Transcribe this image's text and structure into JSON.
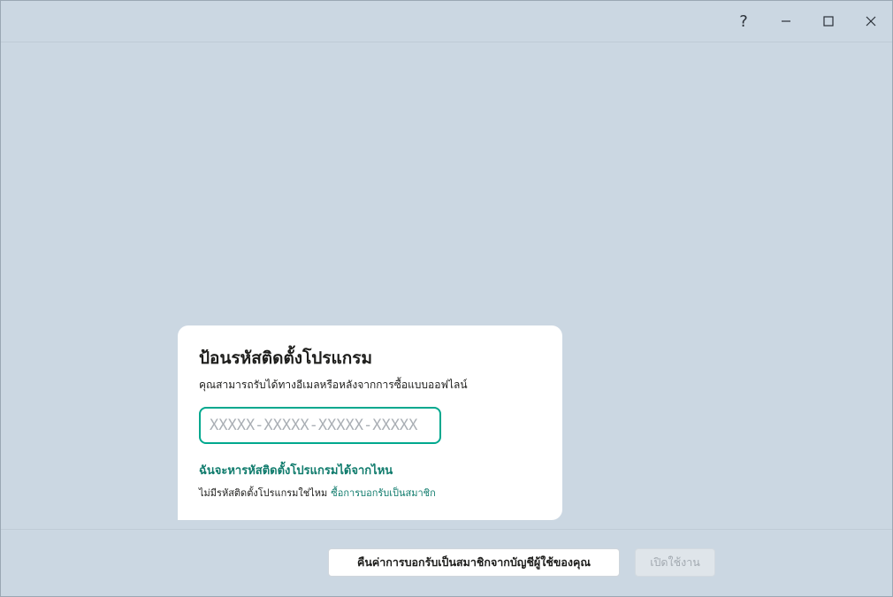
{
  "titlebar": {
    "help_label": "?",
    "icons": [
      "help-icon",
      "minimize-icon",
      "maximize-icon",
      "close-icon"
    ]
  },
  "card": {
    "title": "ป้อนรหัสติดตั้งโปรแกรม",
    "subtitle": "คุณสามารถรับได้ทางอีเมลหรือหลังจากการซื้อแบบออฟไลน์",
    "code_input": {
      "placeholder": "XXXXX-XXXXX-XXXXX-XXXXX",
      "value": ""
    },
    "where_link": "ฉันจะหารหัสติดตั้งโปรแกรมได้จากไหน",
    "no_code_text": "ไม่มีรหัสติดตั้งโปรแกรมใช่ไหม",
    "buy_link": "ซื้อการบอกรับเป็นสมาชิก"
  },
  "footer": {
    "restore_button": "คืนค่าการบอกรับเป็นสมาชิกจากบัญชีผู้ใช้ของคุณ",
    "activate_button": "เปิดใช้งาน"
  },
  "colors": {
    "background": "#cbd7e2",
    "card": "#ffffff",
    "accent": "#00a88e",
    "link": "#0f7b6c",
    "disabled_text": "#a3aab1"
  }
}
